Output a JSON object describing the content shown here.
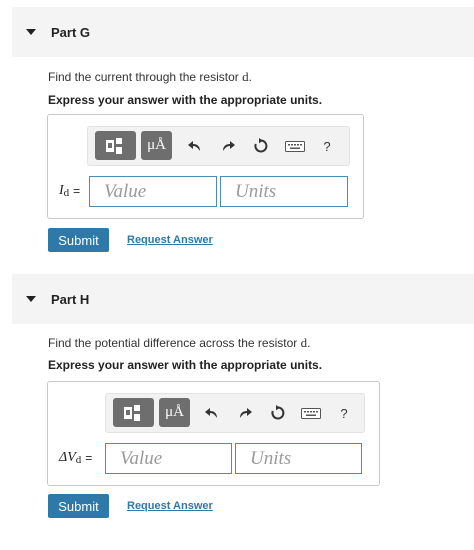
{
  "parts": [
    {
      "title": "Part G",
      "question_prefix": "Find the current through the resistor ",
      "question_var": "d",
      "question_suffix": ".",
      "instruction": "Express your answer with the appropriate units.",
      "lhs_main": "I",
      "lhs_sub": "d",
      "lhs_eq": "=",
      "value_placeholder": "Value",
      "units_placeholder": "Units",
      "submit_label": "Submit",
      "request_label": "Request Answer",
      "toolbar": {
        "mu_label": "μÅ",
        "help_label": "?"
      }
    },
    {
      "title": "Part H",
      "question_prefix": "Find the potential difference across the resistor ",
      "question_var": "d",
      "question_suffix": ".",
      "instruction": "Express your answer with the appropriate units.",
      "lhs_main": "ΔV",
      "lhs_sub": "d",
      "lhs_eq": "=",
      "value_placeholder": "Value",
      "units_placeholder": "Units",
      "submit_label": "Submit",
      "request_label": "Request Answer",
      "toolbar": {
        "mu_label": "μÅ",
        "help_label": "?"
      }
    }
  ],
  "icons": [
    "caret-down-icon",
    "templates-icon",
    "units-icon",
    "undo-icon",
    "redo-icon",
    "reset-icon",
    "keyboard-icon",
    "help-icon"
  ]
}
